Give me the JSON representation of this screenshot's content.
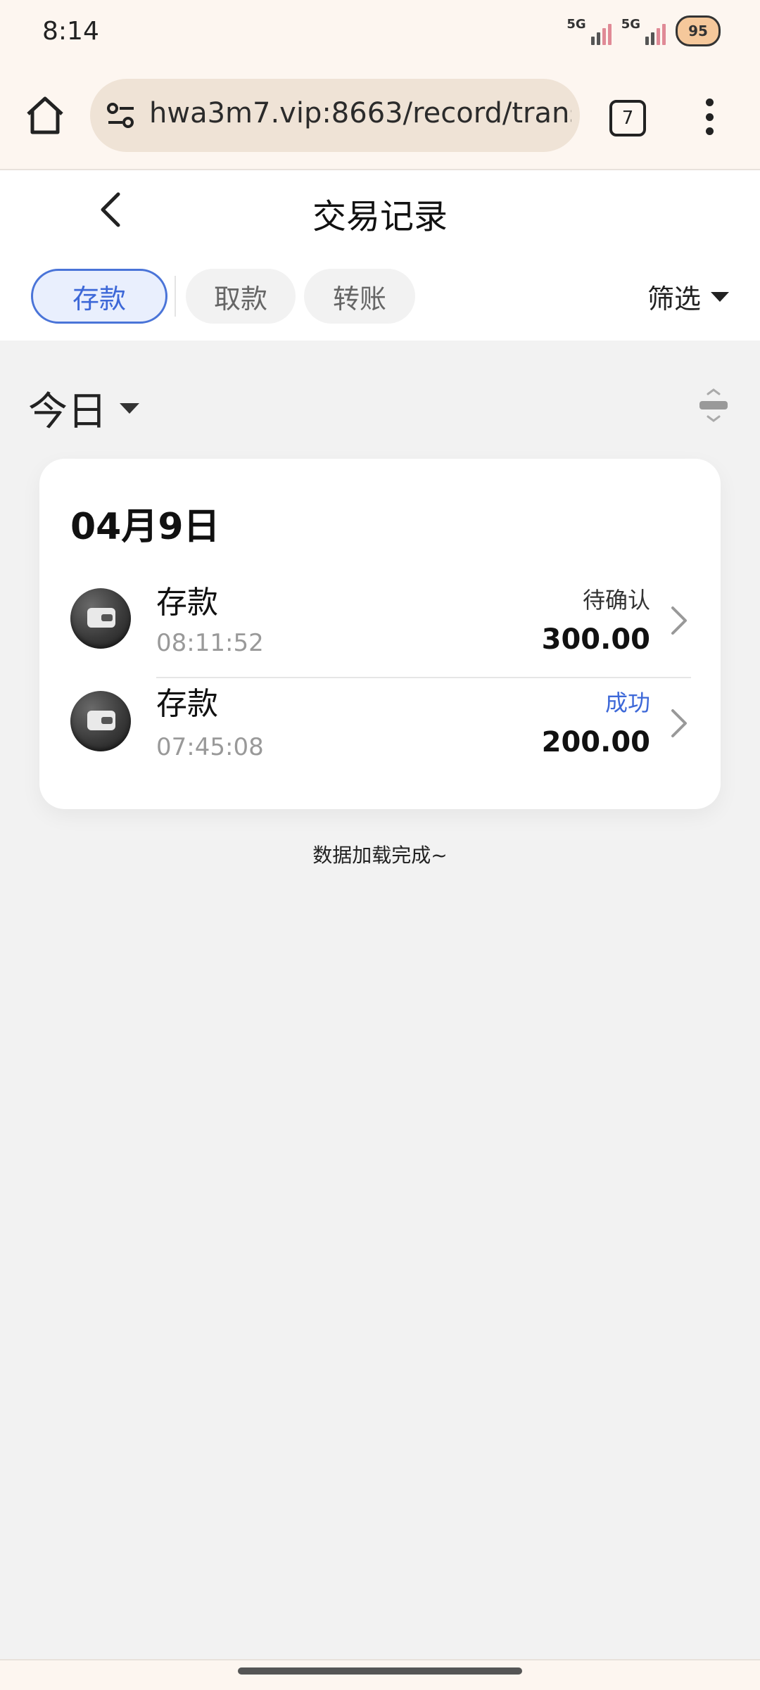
{
  "status_bar": {
    "time": "8:14",
    "network1": "5G",
    "network2": "5G",
    "battery": "95"
  },
  "browser": {
    "url": "hwa3m7.vip:8663/record/trans",
    "tab_count": "7"
  },
  "header": {
    "title": "交易记录"
  },
  "tabs": [
    {
      "label": "存款",
      "active": true
    },
    {
      "label": "取款",
      "active": false
    },
    {
      "label": "转账",
      "active": false
    }
  ],
  "filter": {
    "label": "筛选"
  },
  "period": {
    "label": "今日"
  },
  "day_group": {
    "date": "04月9日",
    "records": [
      {
        "type": "存款",
        "time": "08:11:52",
        "status": "待确认",
        "amount": "300.00"
      },
      {
        "type": "存款",
        "time": "07:45:08",
        "status": "成功",
        "amount": "200.00"
      }
    ]
  },
  "footer_text": "数据加载完成~",
  "colors": {
    "accent": "#3d68d8",
    "success": "#3d68d8",
    "background": "#f2f2f2"
  }
}
